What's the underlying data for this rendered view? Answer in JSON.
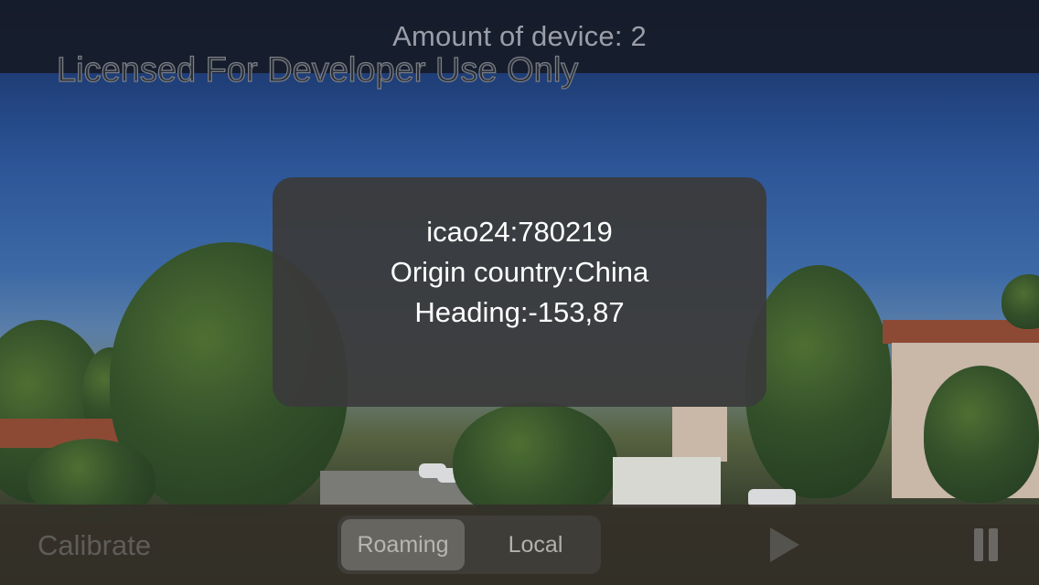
{
  "header": {
    "device_count_text": "Amount of device: 2",
    "watermark_text": "Licensed For Developer Use Only"
  },
  "info_card": {
    "icao24": "icao24:780219",
    "origin_country": "Origin country:China",
    "heading": "Heading:-153,87"
  },
  "toolbar": {
    "calibrate_label": "Calibrate",
    "modes": [
      {
        "label": "Roaming",
        "selected": true
      },
      {
        "label": "Local",
        "selected": false
      }
    ],
    "play_icon": "play-icon",
    "pause_icon": "pause-icon"
  },
  "colors": {
    "top_bar": "#161c2a",
    "card_background": "#3a3a3a",
    "bottom_bar": "#343028",
    "segment_selected": "#676560"
  }
}
